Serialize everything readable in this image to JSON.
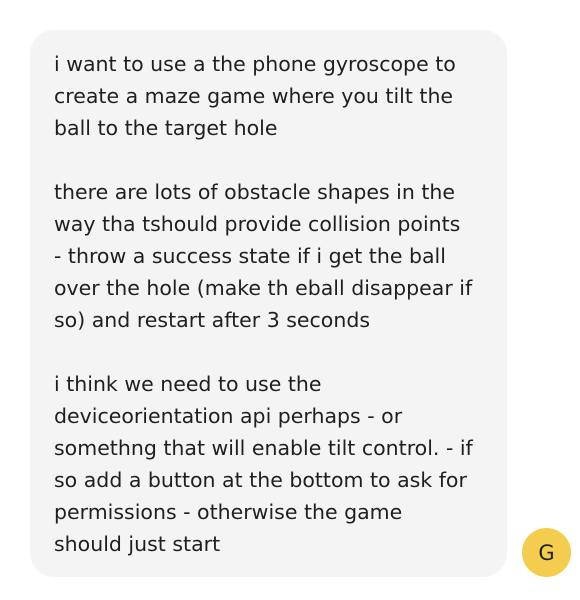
{
  "message": {
    "paragraphs": [
      "i want to use a the phone gyroscope to\ncreate a maze game where you tilt the\nball to the target hole",
      "there are lots of obstacle shapes in the\nway tha tshould provide collision points\n- throw a success state if i get the ball\nover the hole (make th eball disappear if\nso) and restart after 3 seconds",
      "i think we need to use the\ndeviceorientation api perhaps - or\nsomethng that will enable tilt control. - if\nso add a button at the bottom to ask for\npermissions - otherwise the game\nshould just start"
    ]
  },
  "user": {
    "avatar_initial": "G",
    "avatar_color": "#f4cd4e"
  },
  "colors": {
    "bubble_background": "#f4f4f4",
    "text": "#1f1f1f"
  }
}
